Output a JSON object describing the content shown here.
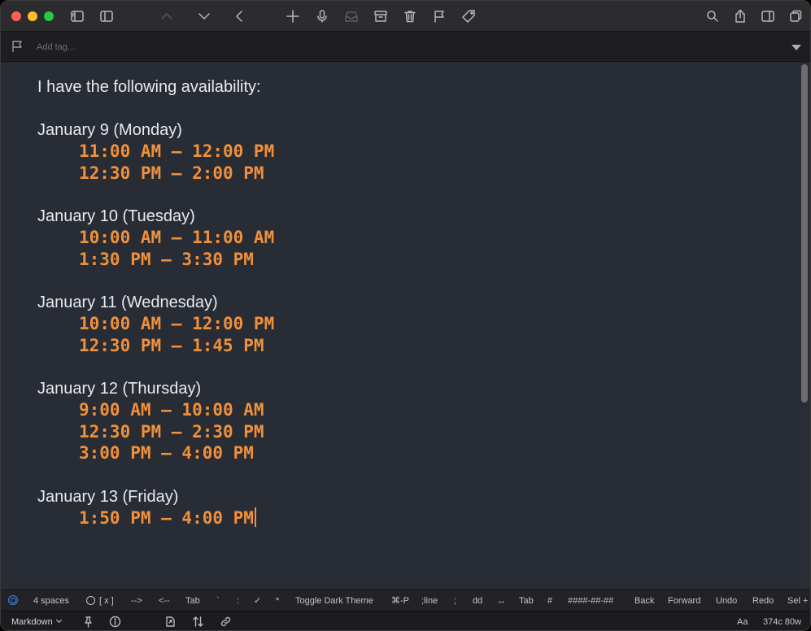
{
  "toolbar": {
    "icons": [
      "sidebar-icon",
      "panel-icon",
      "chevron-up-icon",
      "chevron-down-icon",
      "back-icon",
      "new-note-icon",
      "microphone-icon",
      "inbox-icon",
      "archive-icon",
      "trash-icon",
      "flag-icon",
      "tag-icon",
      "search-icon",
      "share-icon",
      "split-view-icon",
      "copy-window-icon"
    ]
  },
  "tagbar": {
    "placeholder": "Add tag..."
  },
  "note": {
    "intro": "I have the following availability:",
    "days": [
      {
        "heading": "January 9 (Monday)",
        "slots": [
          "11:00 AM – 12:00 PM",
          "12:30 PM – 2:00 PM"
        ]
      },
      {
        "heading": "January 10 (Tuesday)",
        "slots": [
          "10:00 AM – 11:00 AM",
          "1:30 PM – 3:30 PM"
        ]
      },
      {
        "heading": "January 11 (Wednesday)",
        "slots": [
          "10:00 AM – 12:00 PM",
          "12:30 PM – 1:45 PM"
        ]
      },
      {
        "heading": "January 12 (Thursday)",
        "slots": [
          "9:00 AM – 10:00 AM",
          "12:30 PM – 2:30 PM",
          "3:00 PM – 4:00 PM"
        ]
      },
      {
        "heading": "January 13 (Friday)",
        "slots": [
          "1:50 PM – 4:00 PM"
        ]
      }
    ]
  },
  "keybar": {
    "keys": [
      "4 spaces",
      "[ x ]",
      "-->",
      "<--",
      "Tab",
      "`",
      ":",
      "✓",
      "*",
      "Toggle Dark Theme",
      "⌘-P",
      ";line",
      ";",
      "dd",
      "↔",
      "Tab",
      "#",
      "####-##-##",
      "Back",
      "Forward",
      "Undo",
      "Redo",
      "Sel +"
    ]
  },
  "status": {
    "mode": "Markdown",
    "font_label": "Aa",
    "counts": "374c 80w"
  },
  "colors": {
    "accent_orange": "#f0903c",
    "editor_bg": "#282c34",
    "ring_blue": "#3b82f6"
  }
}
